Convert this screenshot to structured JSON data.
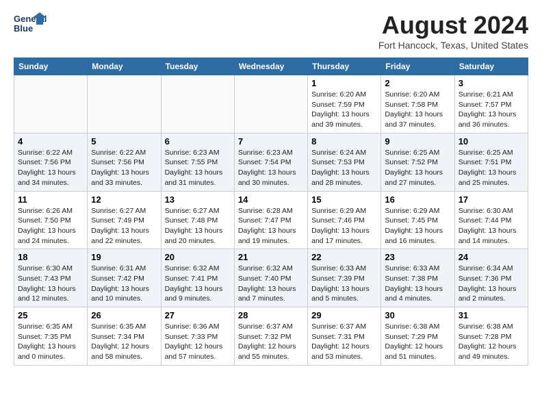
{
  "header": {
    "logo_line1": "General",
    "logo_line2": "Blue",
    "month_year": "August 2024",
    "location": "Fort Hancock, Texas, United States"
  },
  "weekdays": [
    "Sunday",
    "Monday",
    "Tuesday",
    "Wednesday",
    "Thursday",
    "Friday",
    "Saturday"
  ],
  "weeks": [
    [
      {
        "day": "",
        "info": ""
      },
      {
        "day": "",
        "info": ""
      },
      {
        "day": "",
        "info": ""
      },
      {
        "day": "",
        "info": ""
      },
      {
        "day": "1",
        "info": "Sunrise: 6:20 AM\nSunset: 7:59 PM\nDaylight: 13 hours\nand 39 minutes."
      },
      {
        "day": "2",
        "info": "Sunrise: 6:20 AM\nSunset: 7:58 PM\nDaylight: 13 hours\nand 37 minutes."
      },
      {
        "day": "3",
        "info": "Sunrise: 6:21 AM\nSunset: 7:57 PM\nDaylight: 13 hours\nand 36 minutes."
      }
    ],
    [
      {
        "day": "4",
        "info": "Sunrise: 6:22 AM\nSunset: 7:56 PM\nDaylight: 13 hours\nand 34 minutes."
      },
      {
        "day": "5",
        "info": "Sunrise: 6:22 AM\nSunset: 7:56 PM\nDaylight: 13 hours\nand 33 minutes."
      },
      {
        "day": "6",
        "info": "Sunrise: 6:23 AM\nSunset: 7:55 PM\nDaylight: 13 hours\nand 31 minutes."
      },
      {
        "day": "7",
        "info": "Sunrise: 6:23 AM\nSunset: 7:54 PM\nDaylight: 13 hours\nand 30 minutes."
      },
      {
        "day": "8",
        "info": "Sunrise: 6:24 AM\nSunset: 7:53 PM\nDaylight: 13 hours\nand 28 minutes."
      },
      {
        "day": "9",
        "info": "Sunrise: 6:25 AM\nSunset: 7:52 PM\nDaylight: 13 hours\nand 27 minutes."
      },
      {
        "day": "10",
        "info": "Sunrise: 6:25 AM\nSunset: 7:51 PM\nDaylight: 13 hours\nand 25 minutes."
      }
    ],
    [
      {
        "day": "11",
        "info": "Sunrise: 6:26 AM\nSunset: 7:50 PM\nDaylight: 13 hours\nand 24 minutes."
      },
      {
        "day": "12",
        "info": "Sunrise: 6:27 AM\nSunset: 7:49 PM\nDaylight: 13 hours\nand 22 minutes."
      },
      {
        "day": "13",
        "info": "Sunrise: 6:27 AM\nSunset: 7:48 PM\nDaylight: 13 hours\nand 20 minutes."
      },
      {
        "day": "14",
        "info": "Sunrise: 6:28 AM\nSunset: 7:47 PM\nDaylight: 13 hours\nand 19 minutes."
      },
      {
        "day": "15",
        "info": "Sunrise: 6:29 AM\nSunset: 7:46 PM\nDaylight: 13 hours\nand 17 minutes."
      },
      {
        "day": "16",
        "info": "Sunrise: 6:29 AM\nSunset: 7:45 PM\nDaylight: 13 hours\nand 16 minutes."
      },
      {
        "day": "17",
        "info": "Sunrise: 6:30 AM\nSunset: 7:44 PM\nDaylight: 13 hours\nand 14 minutes."
      }
    ],
    [
      {
        "day": "18",
        "info": "Sunrise: 6:30 AM\nSunset: 7:43 PM\nDaylight: 13 hours\nand 12 minutes."
      },
      {
        "day": "19",
        "info": "Sunrise: 6:31 AM\nSunset: 7:42 PM\nDaylight: 13 hours\nand 10 minutes."
      },
      {
        "day": "20",
        "info": "Sunrise: 6:32 AM\nSunset: 7:41 PM\nDaylight: 13 hours\nand 9 minutes."
      },
      {
        "day": "21",
        "info": "Sunrise: 6:32 AM\nSunset: 7:40 PM\nDaylight: 13 hours\nand 7 minutes."
      },
      {
        "day": "22",
        "info": "Sunrise: 6:33 AM\nSunset: 7:39 PM\nDaylight: 13 hours\nand 5 minutes."
      },
      {
        "day": "23",
        "info": "Sunrise: 6:33 AM\nSunset: 7:38 PM\nDaylight: 13 hours\nand 4 minutes."
      },
      {
        "day": "24",
        "info": "Sunrise: 6:34 AM\nSunset: 7:36 PM\nDaylight: 13 hours\nand 2 minutes."
      }
    ],
    [
      {
        "day": "25",
        "info": "Sunrise: 6:35 AM\nSunset: 7:35 PM\nDaylight: 13 hours\nand 0 minutes."
      },
      {
        "day": "26",
        "info": "Sunrise: 6:35 AM\nSunset: 7:34 PM\nDaylight: 12 hours\nand 58 minutes."
      },
      {
        "day": "27",
        "info": "Sunrise: 6:36 AM\nSunset: 7:33 PM\nDaylight: 12 hours\nand 57 minutes."
      },
      {
        "day": "28",
        "info": "Sunrise: 6:37 AM\nSunset: 7:32 PM\nDaylight: 12 hours\nand 55 minutes."
      },
      {
        "day": "29",
        "info": "Sunrise: 6:37 AM\nSunset: 7:31 PM\nDaylight: 12 hours\nand 53 minutes."
      },
      {
        "day": "30",
        "info": "Sunrise: 6:38 AM\nSunset: 7:29 PM\nDaylight: 12 hours\nand 51 minutes."
      },
      {
        "day": "31",
        "info": "Sunrise: 6:38 AM\nSunset: 7:28 PM\nDaylight: 12 hours\nand 49 minutes."
      }
    ]
  ]
}
